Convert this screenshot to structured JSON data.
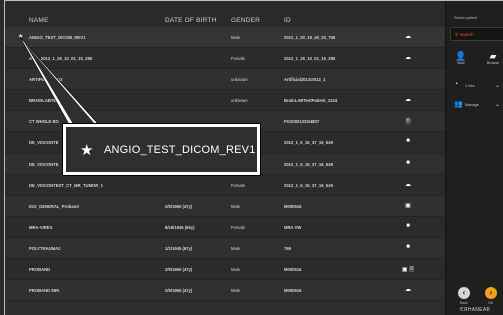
{
  "header": {
    "name": "NAME",
    "dob": "DATE OF BIRTH",
    "gender": "GENDER",
    "id": "ID"
  },
  "rows": [
    {
      "star": "★",
      "name": "ANGIO_TEST_DICOM_REV1",
      "dob": "",
      "gender": "Male",
      "id": "2012_1_20_16_40_20_756",
      "icon": "☁"
    },
    {
      "star": "",
      "name": "AN__ 2012_1_26_10_01_15_285",
      "dob": "",
      "gender": "Female",
      "id": "2012_1_26_10_01_15_285",
      "icon": "☁"
    },
    {
      "star": "",
      "name": "ARTIFICIA_ 2012",
      "dob": "",
      "gender": "unknown",
      "id": "Artificial2012ct012_1",
      "icon": ""
    },
    {
      "star": "",
      "name": "BRAINLABTEST",
      "dob": "",
      "gender": "unknown",
      "id": "BrainLABTestPatient_1234",
      "icon": "☁"
    },
    {
      "star": "",
      "name": "CT WHOLE BO",
      "dob": "",
      "gender": "",
      "id": "PG20001233I4807",
      "icon": "🗎"
    },
    {
      "star": "",
      "name": "DE_VISCONTE",
      "dob": "",
      "gender": "",
      "id": "2012_1_6_15_37_16_549",
      "icon": "■"
    },
    {
      "star": "",
      "name": "DE_VISCONTE",
      "dob": "",
      "gender": "",
      "id": "2012_1_6_15_37_16_549",
      "icon": "■"
    },
    {
      "star": "",
      "name": "DE_VISCONTEST_CT_MR_TUMOR_1",
      "dob": "",
      "gender": "Female",
      "id": "2012_1_6_15_37_16_549",
      "icon": "☁"
    },
    {
      "star": "",
      "name": "IGG_GENERAL_Proband",
      "dob": "2/9/1960 (47y)",
      "gender": "Male",
      "id": "M000516",
      "icon": "▣"
    },
    {
      "star": "",
      "name": "MRA-VIRES",
      "dob": "8/18/1946 (65y)",
      "gender": "Female",
      "id": "MRA VW",
      "icon": "■"
    },
    {
      "star": "",
      "name": "POLYTRAUMA2",
      "dob": "1/1/1945 (67y)",
      "gender": "Male",
      "id": "769",
      "icon": "■"
    },
    {
      "star": "",
      "name": "PROBAND",
      "dob": "2/9/1960 (47y)",
      "gender": "Male",
      "id": "M000516",
      "icon": "▣ 🗎"
    },
    {
      "star": "",
      "name": "PROBAND MRI",
      "dob": "2/9/1960 (47y)",
      "gender": "Male",
      "id": "M000516",
      "icon": "☁"
    }
  ],
  "callout": {
    "star": "★",
    "text": "ANGIO_TEST_DICOM_REV1"
  },
  "side": {
    "label": "Select patient",
    "search_text": "Search",
    "new_label": "New",
    "browse_label": "Browse",
    "dd1_label": "1 Sec",
    "dd2_label": "Manage",
    "back_label": "Back",
    "next_label": "OK",
    "footer": "ЄЯHANEAB"
  },
  "colors": {
    "accent": "#f2a31b",
    "search_text": "#e05a2a",
    "callout_border": "#ffffff"
  },
  "icons": {
    "star": "star-icon",
    "cloud": "cloud-icon",
    "document": "document-icon",
    "folder": "folder-icon",
    "person": "person-icon",
    "back": "back-arrow-icon",
    "next": "next-arrow-icon",
    "chevron": "chevron-down-icon"
  }
}
